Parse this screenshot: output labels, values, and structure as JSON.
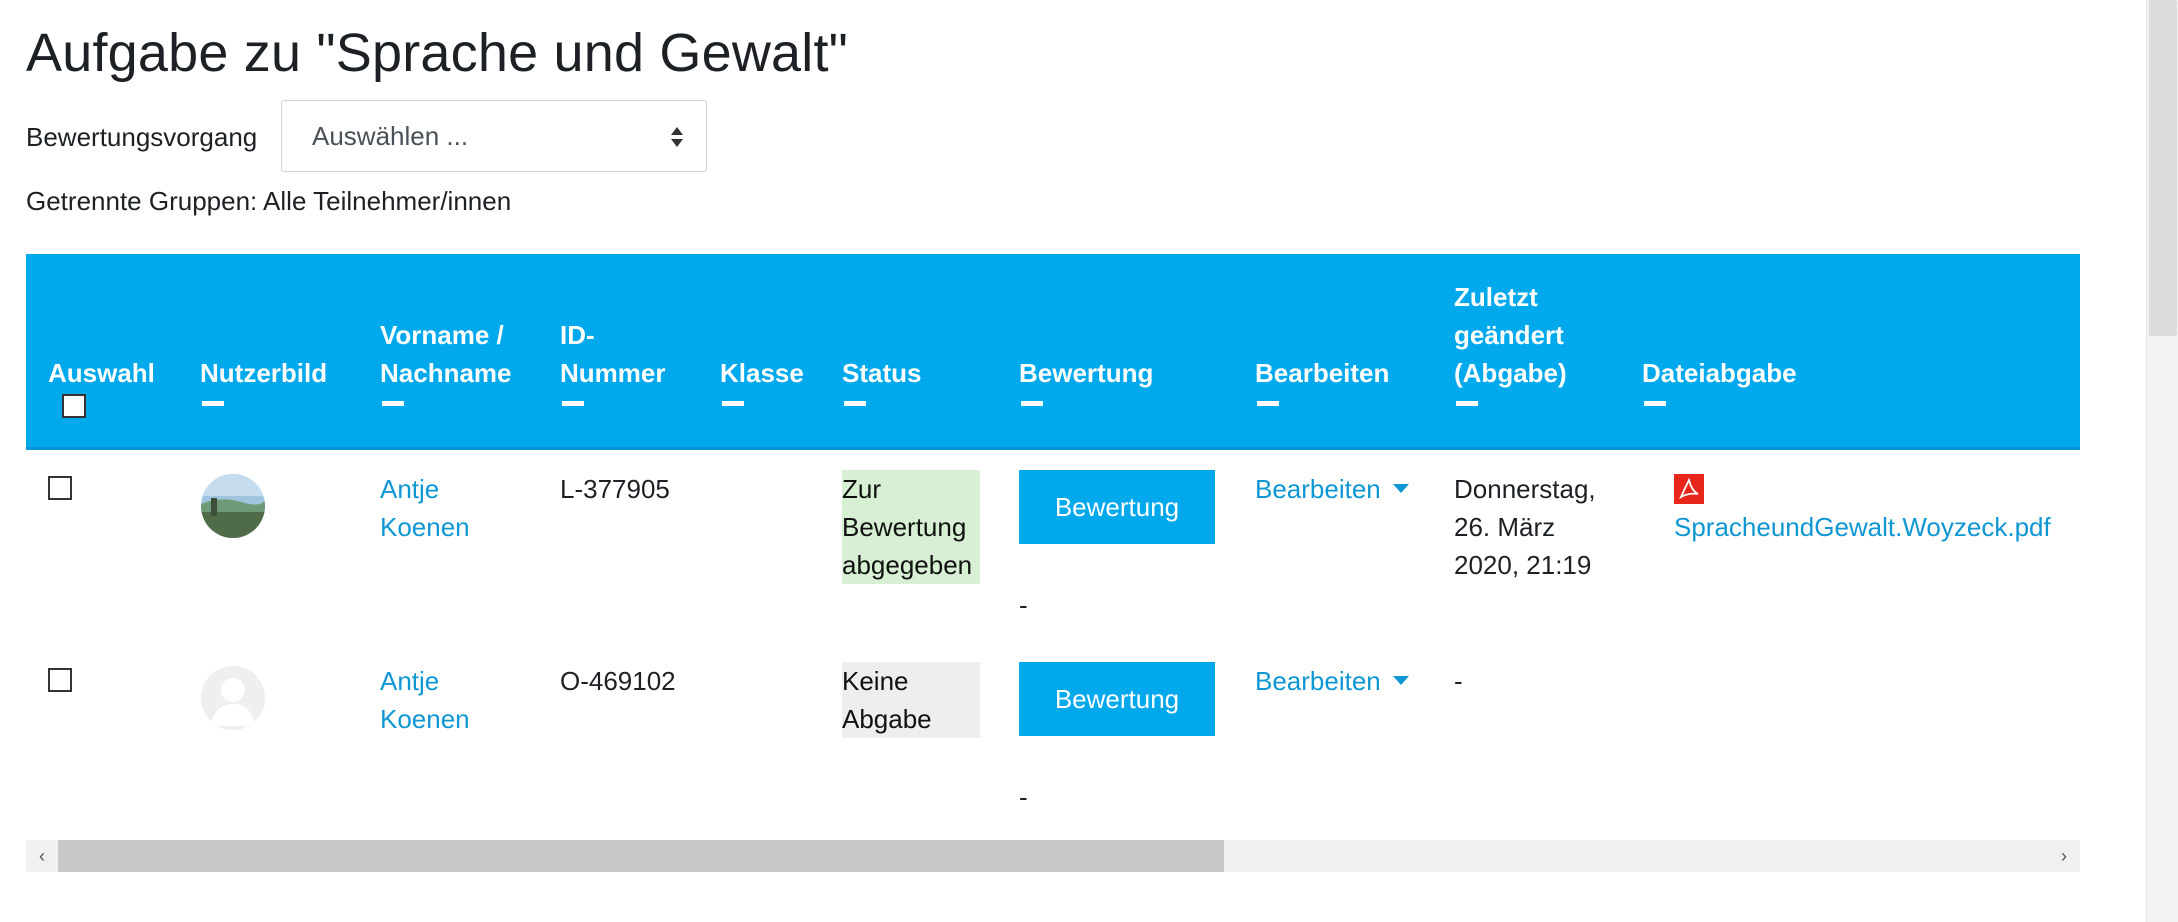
{
  "page": {
    "title": "Aufgabe zu \"Sprache und Gewalt\""
  },
  "grading": {
    "label": "Bewertungsvorgang",
    "selected": "Auswählen ..."
  },
  "groups_text": "Getrennte Gruppen: Alle Teilnehmer/innen",
  "table": {
    "headers": {
      "select": "Auswahl",
      "picture": "Nutzerbild",
      "name_1": "Vorname /",
      "name_2": "Nachname",
      "id_1": "ID-",
      "id_2": "Nummer",
      "klasse": "Klasse",
      "status": "Status",
      "grade": "Bewertung",
      "edit": "Bearbeiten",
      "modified_1": "Zuletzt",
      "modified_2": "geändert",
      "modified_3": "(Abgabe)",
      "file": "Dateiabgabe"
    },
    "rows": [
      {
        "firstname": "Antje",
        "lastname": "Koenen",
        "id": "L-377905",
        "status_1": "Zur",
        "status_2": "Bewertung",
        "status_3": "abgegeben",
        "grade_button": "Bewertung",
        "grade_value": "-",
        "edit_label": "Bearbeiten",
        "modified_1": "Donnerstag,",
        "modified_2": "26. März",
        "modified_3": "2020, 21:19",
        "file": "SpracheundGewalt.Woyzeck.pdf",
        "status_color": "#d7f0d3"
      },
      {
        "firstname": "Antje",
        "lastname": "Koenen",
        "id": "O-469102",
        "status_1": "Keine",
        "status_2": "Abgabe",
        "grade_button": "Bewertung",
        "grade_value": "-",
        "edit_label": "Bearbeiten",
        "modified_1": "-",
        "status_color": "#eeeeee"
      }
    ]
  },
  "colors": {
    "accent": "#00a8ec",
    "link": "#0f97d3"
  },
  "icons": [
    "sort-arrows-icon",
    "collapse-icon",
    "avatar-photo",
    "default-user-icon",
    "caret-down-icon",
    "pdf-icon",
    "scroll-left-icon",
    "scroll-right-icon"
  ]
}
